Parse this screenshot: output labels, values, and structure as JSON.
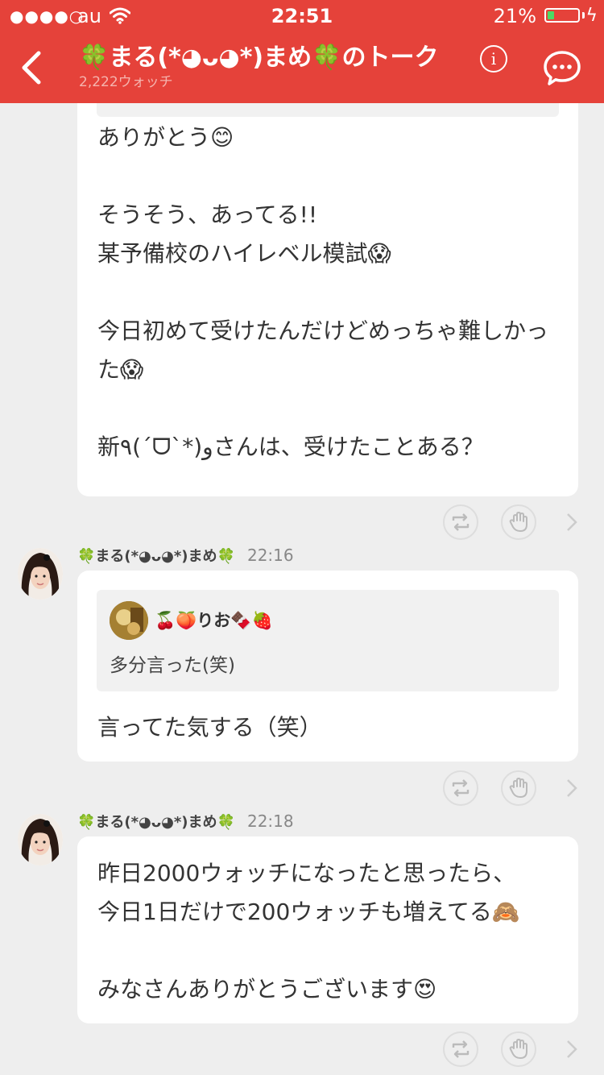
{
  "status_bar": {
    "signal": "●●●●○",
    "carrier": "au",
    "time": "22:51",
    "battery_percent": "21%",
    "battery_level": 0.21
  },
  "header": {
    "title": "🍀まる(*◕ᴗ◕*)まめ🍀のトーク",
    "watch_count": "2,222ウォッチ",
    "info_label": "i"
  },
  "messages": [
    {
      "text": "ありがとう😊\n\nそうそう、あってる!!\n某予備校のハイレベル模試😱\n\n今日初めて受けたんだけどめっちゃ難しかった😱\n\n新٩(´ᗜ`*)وさんは、受けたことある？"
    },
    {
      "sender": "🍀まる(*◕ᴗ◕*)まめ🍀",
      "time": "22:16",
      "quote": {
        "name": "🍒🍑りお🍫🍓",
        "text": "多分言った(笑)"
      },
      "text": "言ってた気する（笑）"
    },
    {
      "sender": "🍀まる(*◕ᴗ◕*)まめ🍀",
      "time": "22:18",
      "text": "昨日2000ウォッチになったと思ったら、\n今日1日だけで200ウォッチも増えてる🙈\n\nみなさんありがとうございます😍"
    }
  ],
  "colors": {
    "header_bg": "#e5423a",
    "background": "#eeeeee",
    "bubble": "#ffffff",
    "battery_fill": "#4cd964"
  },
  "icons": [
    "back-arrow-icon",
    "info-icon",
    "chat-bubble-icon",
    "repost-icon",
    "clap-icon",
    "chevron-right-icon",
    "wifi-icon",
    "battery-icon"
  ]
}
